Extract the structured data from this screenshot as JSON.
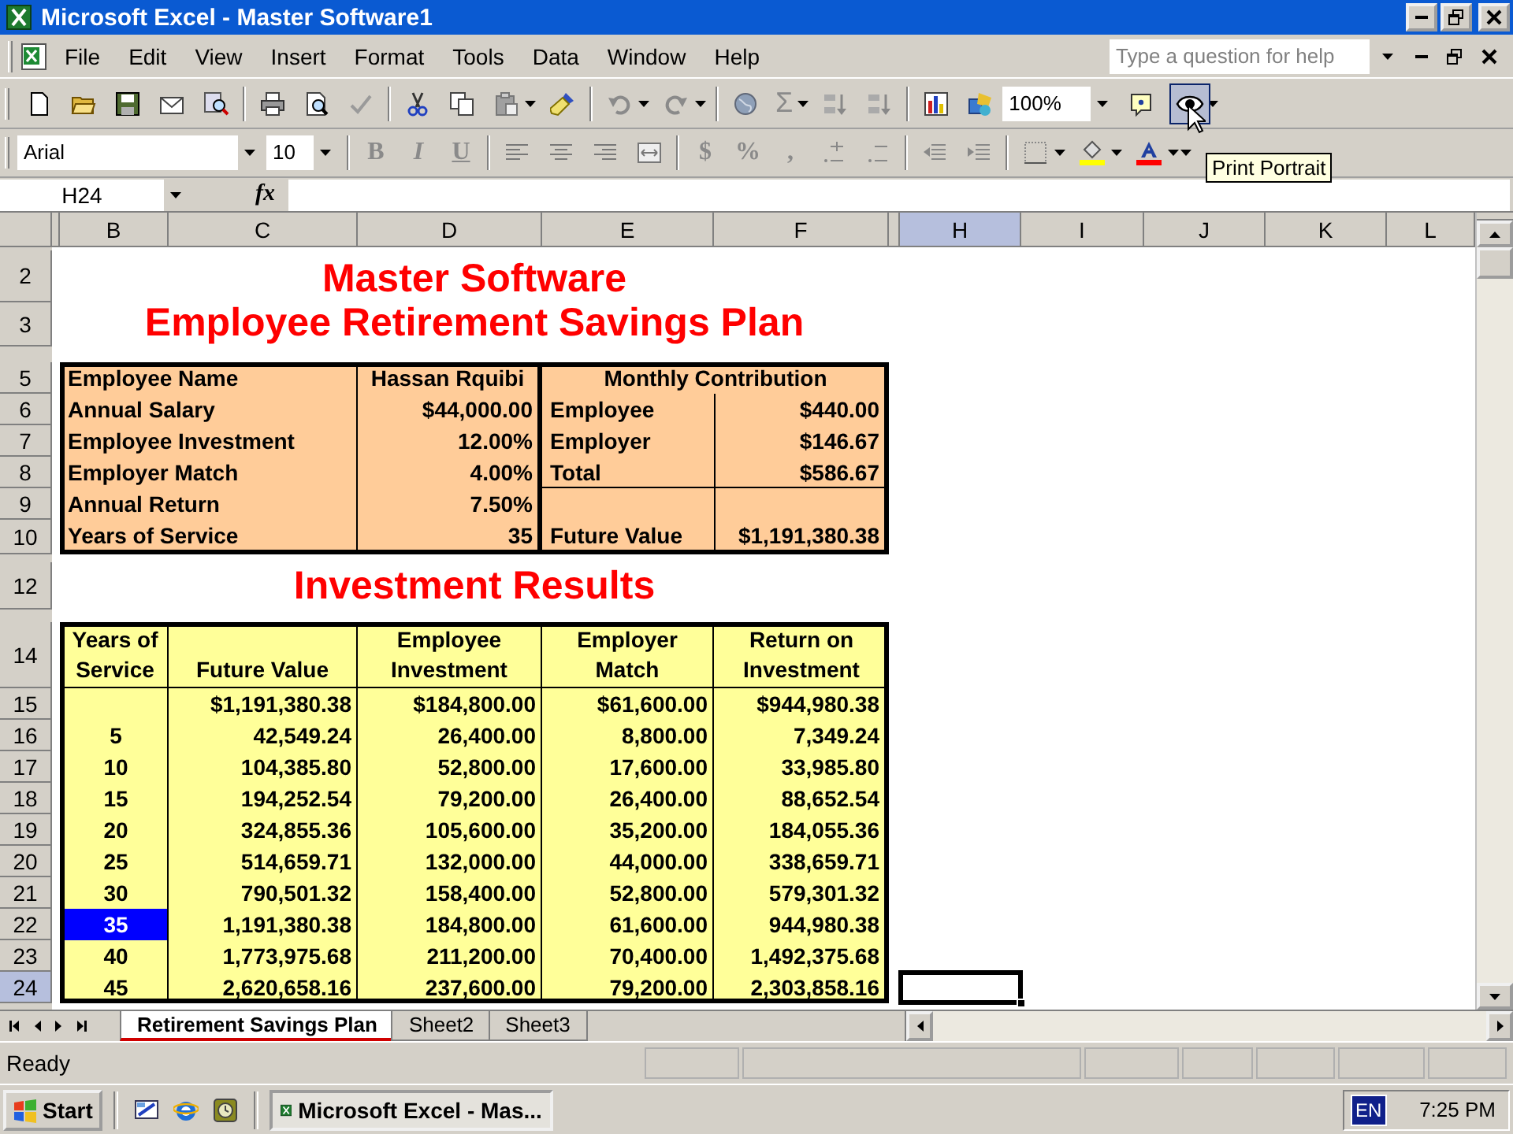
{
  "window": {
    "title": "Microsoft Excel - Master Software1"
  },
  "menu": [
    "File",
    "Edit",
    "View",
    "Insert",
    "Format",
    "Tools",
    "Data",
    "Window",
    "Help"
  ],
  "help_box": {
    "placeholder": "Type a question for help"
  },
  "standard_toolbar": {
    "sum": "Σ",
    "zoom": "100%",
    "view_button": {
      "pressed": true,
      "tooltip": "Print Portrait"
    }
  },
  "formatting_toolbar": {
    "font": "Arial",
    "size": "10",
    "style_buttons": [
      {
        "label": "B",
        "kind": "bold",
        "disabled": true
      },
      {
        "label": "I",
        "kind": "italic",
        "disabled": true
      },
      {
        "label": "U",
        "kind": "underline",
        "disabled": true
      }
    ],
    "number_buttons": [
      {
        "label": "$",
        "disabled": true
      },
      {
        "label": "%",
        "disabled": true
      },
      {
        "label": ",",
        "disabled": true
      }
    ]
  },
  "formula_bar": {
    "name_box": "H24",
    "fx": "fx"
  },
  "columns": [
    {
      "label": "B",
      "selected": false
    },
    {
      "label": "C",
      "selected": false
    },
    {
      "label": "D",
      "selected": false
    },
    {
      "label": "E",
      "selected": false
    },
    {
      "label": "F",
      "selected": false
    },
    {
      "label": "H",
      "selected": true
    },
    {
      "label": "I",
      "selected": false
    },
    {
      "label": "J",
      "selected": false
    },
    {
      "label": "K",
      "selected": false
    },
    {
      "label": "L",
      "selected": false
    }
  ],
  "rows": [
    {
      "label": "2",
      "selected": false
    },
    {
      "label": "3",
      "selected": false
    },
    {
      "label": "5",
      "selected": false
    },
    {
      "label": "6",
      "selected": false
    },
    {
      "label": "7",
      "selected": false
    },
    {
      "label": "8",
      "selected": false
    },
    {
      "label": "9",
      "selected": false
    },
    {
      "label": "10",
      "selected": false
    },
    {
      "label": "12",
      "selected": false
    },
    {
      "label": "14",
      "selected": false
    },
    {
      "label": "15",
      "selected": false
    },
    {
      "label": "16",
      "selected": false
    },
    {
      "label": "17",
      "selected": false
    },
    {
      "label": "18",
      "selected": false
    },
    {
      "label": "19",
      "selected": false
    },
    {
      "label": "20",
      "selected": false
    },
    {
      "label": "21",
      "selected": false
    },
    {
      "label": "22",
      "selected": false
    },
    {
      "label": "23",
      "selected": false
    },
    {
      "label": "24",
      "selected": true
    }
  ],
  "title_lines": [
    "Master Software",
    "Employee Retirement Savings Plan"
  ],
  "employee_info": [
    {
      "label": "Employee Name",
      "value": "Hassan Rquibi"
    },
    {
      "label": "Annual Salary",
      "value": "$44,000.00"
    },
    {
      "label": "Employee Investment",
      "value": "12.00%"
    },
    {
      "label": "Employer Match",
      "value": "4.00%"
    },
    {
      "label": "Annual Return",
      "value": "7.50%"
    },
    {
      "label": "Years of Service",
      "value": "35"
    }
  ],
  "monthly_contribution": {
    "title": "Monthly Contribution",
    "rows": [
      {
        "label": "Employee",
        "value": "$440.00"
      },
      {
        "label": "Employer",
        "value": "$146.67"
      },
      {
        "label": "Total",
        "value": "$586.67"
      }
    ],
    "future_value": {
      "label": "Future Value",
      "value": "$1,191,380.38"
    }
  },
  "results_title": "Investment Results",
  "results": {
    "columns": [
      "Years of Service",
      "Future Value",
      "Employee Investment",
      "Employer Match",
      "Return on Investment"
    ],
    "rows": [
      {
        "values": [
          "$1,191,380.38",
          "$184,800.00",
          "$61,600.00",
          "$944,980.38"
        ],
        "selected": false
      },
      {
        "years": "5",
        "values": [
          "42,549.24",
          "26,400.00",
          "8,800.00",
          "7,349.24"
        ],
        "selected": false
      },
      {
        "years": "10",
        "values": [
          "104,385.80",
          "52,800.00",
          "17,600.00",
          "33,985.80"
        ],
        "selected": false
      },
      {
        "years": "15",
        "values": [
          "194,252.54",
          "79,200.00",
          "26,400.00",
          "88,652.54"
        ],
        "selected": false
      },
      {
        "years": "20",
        "values": [
          "324,855.36",
          "105,600.00",
          "35,200.00",
          "184,055.36"
        ],
        "selected": false
      },
      {
        "years": "25",
        "values": [
          "514,659.71",
          "132,000.00",
          "44,000.00",
          "338,659.71"
        ],
        "selected": false
      },
      {
        "years": "30",
        "values": [
          "790,501.32",
          "158,400.00",
          "52,800.00",
          "579,301.32"
        ],
        "selected": false
      },
      {
        "years": "35",
        "values": [
          "1,191,380.38",
          "184,800.00",
          "61,600.00",
          "944,980.38"
        ],
        "selected": true
      },
      {
        "years": "40",
        "values": [
          "1,773,975.68",
          "211,200.00",
          "70,400.00",
          "1,492,375.68"
        ],
        "selected": false
      },
      {
        "years": "45",
        "values": [
          "2,620,658.16",
          "237,600.00",
          "79,200.00",
          "2,303,858.16"
        ],
        "selected": false
      }
    ]
  },
  "sheet_tabs": [
    {
      "label": "Retirement Savings Plan",
      "selected": true
    },
    {
      "label": "Sheet2",
      "selected": false
    },
    {
      "label": "Sheet3",
      "selected": false
    }
  ],
  "status_bar": {
    "text": "Ready"
  },
  "taskbar": {
    "start": "Start",
    "tasks": [
      {
        "label": "Microsoft Excel - Mas...",
        "selected": true
      }
    ],
    "language": "EN",
    "clock": "7:25 PM"
  }
}
